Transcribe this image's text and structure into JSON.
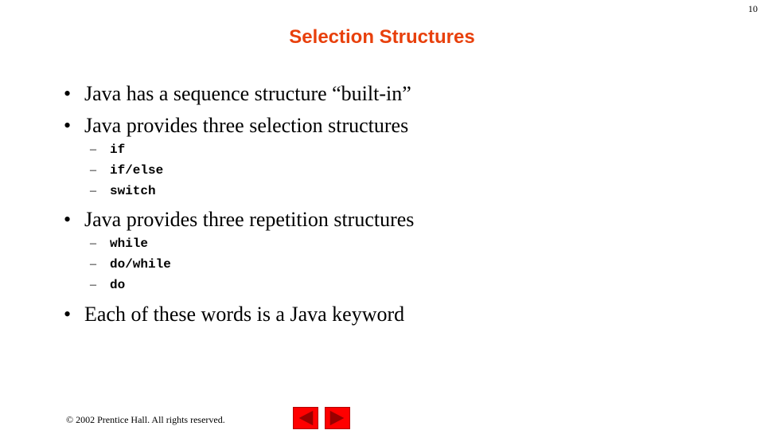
{
  "slide": {
    "page_number": "10",
    "title": "Selection Structures",
    "colors": {
      "title": "#e8400c",
      "nav_button": "#ff0000",
      "nav_arrow": "#990000"
    },
    "bullets": [
      {
        "text": "Java has a sequence structure “built-in”",
        "subitems": []
      },
      {
        "text": "Java provides three selection structures",
        "subitems": [
          "if",
          "if/else",
          "switch"
        ]
      },
      {
        "text": "Java provides three repetition structures",
        "subitems": [
          "while",
          "do/while",
          "do"
        ]
      },
      {
        "text": "Each of these words is a Java keyword",
        "subitems": []
      }
    ],
    "bullet_glyph": "•",
    "sub_glyph": "–",
    "footer": "© 2002 Prentice Hall.  All rights reserved.",
    "nav": {
      "prev_icon": "triangle-left-icon",
      "next_icon": "triangle-right-icon"
    }
  }
}
